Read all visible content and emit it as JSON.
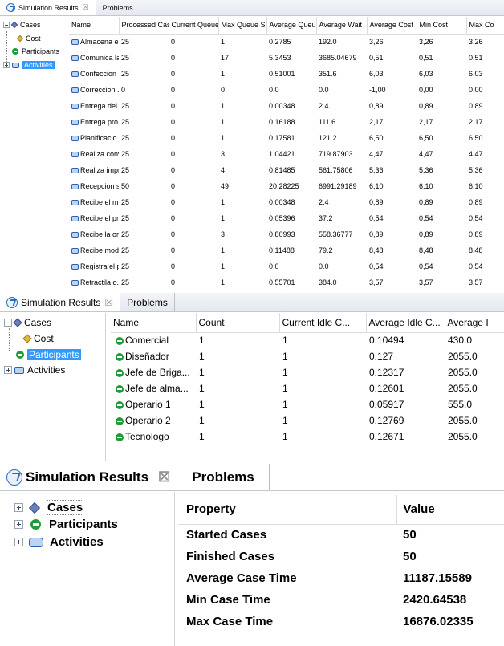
{
  "panel1": {
    "tabs": {
      "results": "Simulation Results",
      "close": "☒",
      "problems": "Problems"
    },
    "tree": {
      "cases": "Cases",
      "cost": "Cost",
      "participants": "Participants",
      "activities": "Activities"
    },
    "columns": [
      "Name",
      "Processed Cases",
      "Current Queue...",
      "Max Queue Size",
      "Average Queu...",
      "Average Wait",
      "Average Cost",
      "Min Cost",
      "Max Co"
    ],
    "rows": [
      [
        "Almacena el...",
        "25",
        "0",
        "1",
        "0.2785",
        "192.0",
        "3,26",
        "3,26",
        "3,26"
      ],
      [
        "Comunica la...",
        "25",
        "0",
        "17",
        "5.3453",
        "3685.04679",
        "0,51",
        "0,51",
        "0,51"
      ],
      [
        "Confeccion ...",
        "25",
        "0",
        "1",
        "0.51001",
        "351.6",
        "6,03",
        "6,03",
        "6,03"
      ],
      [
        "Correccion ...",
        "0",
        "0",
        "0",
        "0.0",
        "0.0",
        "-1,00",
        "0,00",
        "0,00"
      ],
      [
        "Entrega del ...",
        "25",
        "0",
        "1",
        "0.00348",
        "2.4",
        "0,89",
        "0,89",
        "0,89"
      ],
      [
        "Entrega pro...",
        "25",
        "0",
        "1",
        "0.16188",
        "111.6",
        "2,17",
        "2,17",
        "2,17"
      ],
      [
        "Planificacio...",
        "25",
        "0",
        "1",
        "0.17581",
        "121.2",
        "6,50",
        "6,50",
        "6,50"
      ],
      [
        "Realiza conv...",
        "25",
        "0",
        "3",
        "1.04421",
        "719.87903",
        "4,47",
        "4,47",
        "4,47"
      ],
      [
        "Realiza impr...",
        "25",
        "0",
        "4",
        "0.81485",
        "561.75806",
        "5,36",
        "5,36",
        "5,36"
      ],
      [
        "Recepcion s...",
        "50",
        "0",
        "49",
        "20.28225",
        "6991.29189",
        "6,10",
        "6,10",
        "6,10"
      ],
      [
        "Recibe el m...",
        "25",
        "0",
        "1",
        "0.00348",
        "2.4",
        "0,89",
        "0,89",
        "0,89"
      ],
      [
        "Recibe el pr...",
        "25",
        "0",
        "1",
        "0.05396",
        "37.2",
        "0,54",
        "0,54",
        "0,54"
      ],
      [
        "Recibe la or...",
        "25",
        "0",
        "3",
        "0.80993",
        "558.36777",
        "0,89",
        "0,89",
        "0,89"
      ],
      [
        "Recibe mod...",
        "25",
        "0",
        "1",
        "0.11488",
        "79.2",
        "8,48",
        "8,48",
        "8,48"
      ],
      [
        "Registra el p...",
        "25",
        "0",
        "1",
        "0.0",
        "0.0",
        "0,54",
        "0,54",
        "0,54"
      ],
      [
        "Retractila o...",
        "25",
        "0",
        "1",
        "0.55701",
        "384.0",
        "3,57",
        "3,57",
        "3,57"
      ]
    ]
  },
  "panel2": {
    "tabs": {
      "results": "Simulation Results",
      "close": "☒",
      "problems": "Problems"
    },
    "tree": {
      "cases": "Cases",
      "cost": "Cost",
      "participants": "Participants",
      "activities": "Activities"
    },
    "columns": [
      "Name",
      "Count",
      "Current Idle C...",
      "Average Idle C...",
      "Average I"
    ],
    "rows": [
      [
        "Comercial",
        "1",
        "1",
        "0.10494",
        "430.0"
      ],
      [
        "Diseñador",
        "1",
        "1",
        "0.127",
        "2055.0"
      ],
      [
        "Jefe de Briga...",
        "1",
        "1",
        "0.12317",
        "2055.0"
      ],
      [
        "Jefe de alma...",
        "1",
        "1",
        "0.12601",
        "2055.0"
      ],
      [
        "Operario 1",
        "1",
        "1",
        "0.05917",
        "555.0"
      ],
      [
        "Operario 2",
        "1",
        "1",
        "0.12769",
        "2055.0"
      ],
      [
        "Tecnologo",
        "1",
        "1",
        "0.12671",
        "2055.0"
      ]
    ]
  },
  "panel3": {
    "tabs": {
      "results": "Simulation Results",
      "close": "☒",
      "problems": "Problems"
    },
    "tree": {
      "cases": "Cases",
      "participants": "Participants",
      "activities": "Activities"
    },
    "columns": [
      "Property",
      "Value"
    ],
    "rows": [
      [
        "Started Cases",
        "50"
      ],
      [
        "Finished Cases",
        "50"
      ],
      [
        "Average Case Time",
        "11187.15589"
      ],
      [
        "Min Case Time",
        "2420.64538"
      ],
      [
        "Max Case Time",
        "16876.02335"
      ]
    ]
  }
}
